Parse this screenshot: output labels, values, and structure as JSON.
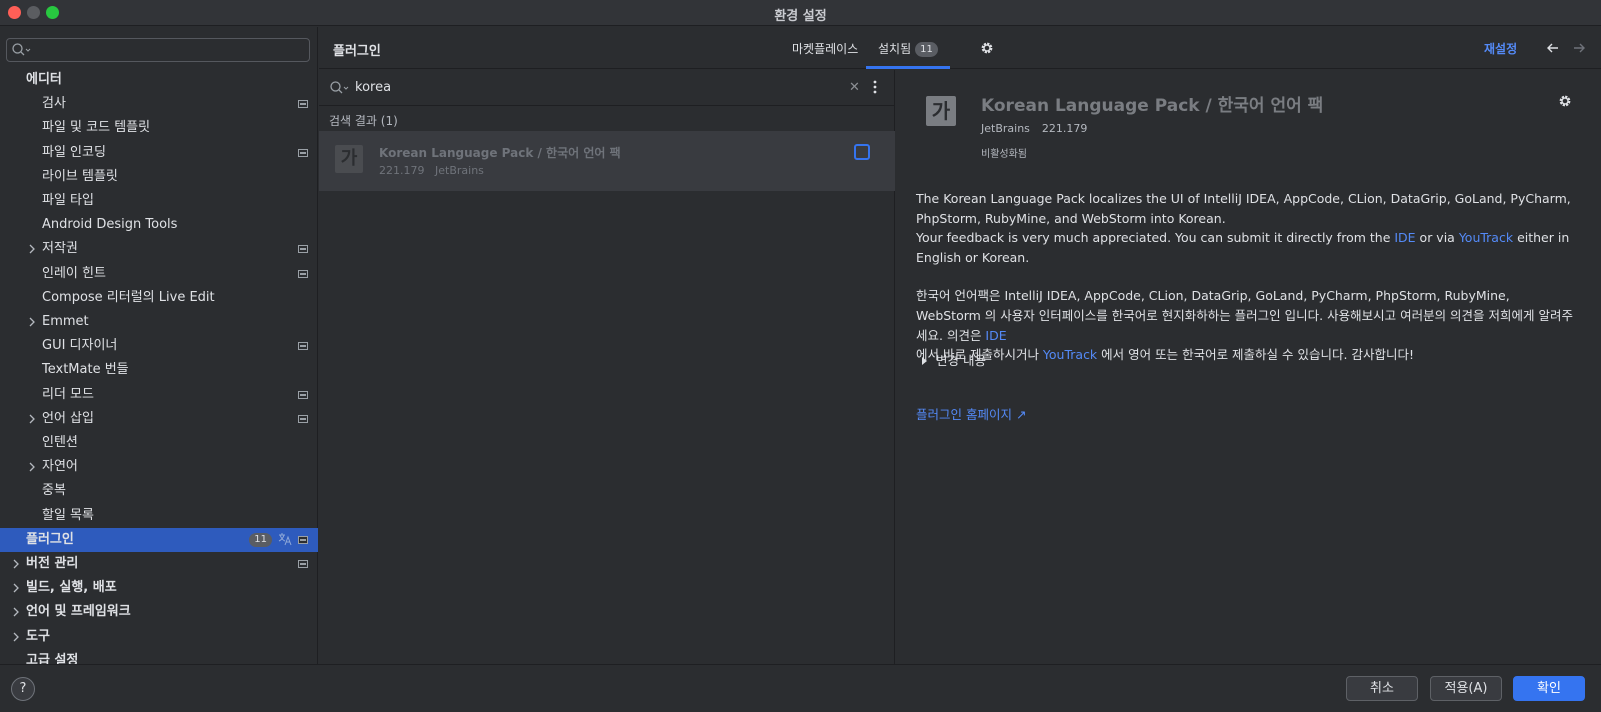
{
  "window": {
    "title": "환경 설정"
  },
  "sidebar": {
    "search_placeholder": "",
    "items": [
      {
        "label": "에디터",
        "bold": true,
        "indent": 0,
        "chevron": false,
        "proj": false
      },
      {
        "label": "검사",
        "indent": 1,
        "chevron": false,
        "proj": true
      },
      {
        "label": "파일 및 코드 템플릿",
        "indent": 1,
        "chevron": false,
        "proj": false
      },
      {
        "label": "파일 인코딩",
        "indent": 1,
        "chevron": false,
        "proj": true
      },
      {
        "label": "라이브 템플릿",
        "indent": 1,
        "chevron": false,
        "proj": false
      },
      {
        "label": "파일 타입",
        "indent": 1,
        "chevron": false,
        "proj": false
      },
      {
        "label": "Android Design Tools",
        "indent": 1,
        "chevron": false,
        "proj": false
      },
      {
        "label": "저작권",
        "indent": 1,
        "chevron": true,
        "proj": true
      },
      {
        "label": "인레이 힌트",
        "indent": 1,
        "chevron": false,
        "proj": true
      },
      {
        "label": "Compose 리터럴의 Live Edit",
        "indent": 1,
        "chevron": false,
        "proj": false
      },
      {
        "label": "Emmet",
        "indent": 1,
        "chevron": true,
        "proj": false
      },
      {
        "label": "GUI 디자이너",
        "indent": 1,
        "chevron": false,
        "proj": true
      },
      {
        "label": "TextMate 번들",
        "indent": 1,
        "chevron": false,
        "proj": false
      },
      {
        "label": "리더 모드",
        "indent": 1,
        "chevron": false,
        "proj": true
      },
      {
        "label": "언어 삽입",
        "indent": 1,
        "chevron": true,
        "proj": true
      },
      {
        "label": "인텐션",
        "indent": 1,
        "chevron": false,
        "proj": false
      },
      {
        "label": "자연어",
        "indent": 1,
        "chevron": true,
        "proj": false
      },
      {
        "label": "중복",
        "indent": 1,
        "chevron": false,
        "proj": false
      },
      {
        "label": "할일 목록",
        "indent": 1,
        "chevron": false,
        "proj": false
      },
      {
        "label": "플러그인",
        "bold": true,
        "indent": 0,
        "chevron": false,
        "proj": true,
        "selected": true,
        "badge": "11",
        "lang": true
      },
      {
        "label": "버전 관리",
        "bold": true,
        "indent": 0,
        "chevron": true,
        "proj": true
      },
      {
        "label": "빌드, 실행, 배포",
        "bold": true,
        "indent": 0,
        "chevron": true,
        "proj": false
      },
      {
        "label": "언어 및 프레임워크",
        "bold": true,
        "indent": 0,
        "chevron": true,
        "proj": false
      },
      {
        "label": "도구",
        "bold": true,
        "indent": 0,
        "chevron": true,
        "proj": false
      },
      {
        "label": "고급 설정",
        "bold": true,
        "indent": 0,
        "chevron": false,
        "proj": false
      }
    ]
  },
  "header": {
    "page_title": "플러그인",
    "tab_marketplace": "마켓플레이스",
    "tab_installed": "설치됨",
    "installed_count": "11",
    "reinstall": "재설정"
  },
  "search": {
    "query": "korea",
    "results_label": "검색 결과 (1)"
  },
  "plugin": {
    "logo_glyph": "가",
    "name": "Korean Language Pack / 한국어 언어 팩",
    "version": "221.179",
    "vendor": "JetBrains",
    "status": "비활성화됨",
    "enabled": false
  },
  "detail": {
    "desc1_a": "The Korean Language Pack localizes the UI of IntelliJ IDEA, AppCode, CLion, DataGrip, GoLand, PyCharm, PhpStorm, RubyMine, and WebStorm into Korean.",
    "desc1_b": "Your feedback is very much appreciated. You can submit it directly from the ",
    "link_ide": "IDE",
    "desc1_c": " or via ",
    "link_youtrack": "YouTrack",
    "desc1_d": " either in English or Korean.",
    "desc2_a": "한국어 언어팩은 IntelliJ IDEA, AppCode, CLion, DataGrip, GoLand, PyCharm, PhpStorm, RubyMine, WebStorm 의 사용자 인터페이스를 한국어로 현지화하하는 플러그인 입니다. 사용해보시고 여러분의 의견을 저희에게 알려주세요. 의견은 ",
    "desc2_b": "에서 바로 제출하시거나 ",
    "desc2_c": " 에서 영어 또는 한국어로 제출하실 수 있습니다. 감사합니다!",
    "changes": "변경 내용",
    "homepage": "플러그인 홈페이지 ↗"
  },
  "footer": {
    "help": "?",
    "cancel": "취소",
    "apply": "적용(A)",
    "ok": "확인"
  },
  "colors": {
    "accent": "#3574f0",
    "link": "#548af7",
    "selection": "#2e5bbd",
    "background": "#2b2d30"
  },
  "icons": {
    "search": "search-icon",
    "settings": "gear-icon",
    "back": "arrow-left-icon",
    "forward": "arrow-right-icon",
    "project_scope": "project-scope-icon",
    "language": "translate-icon",
    "expand": "chevron-right-icon"
  }
}
